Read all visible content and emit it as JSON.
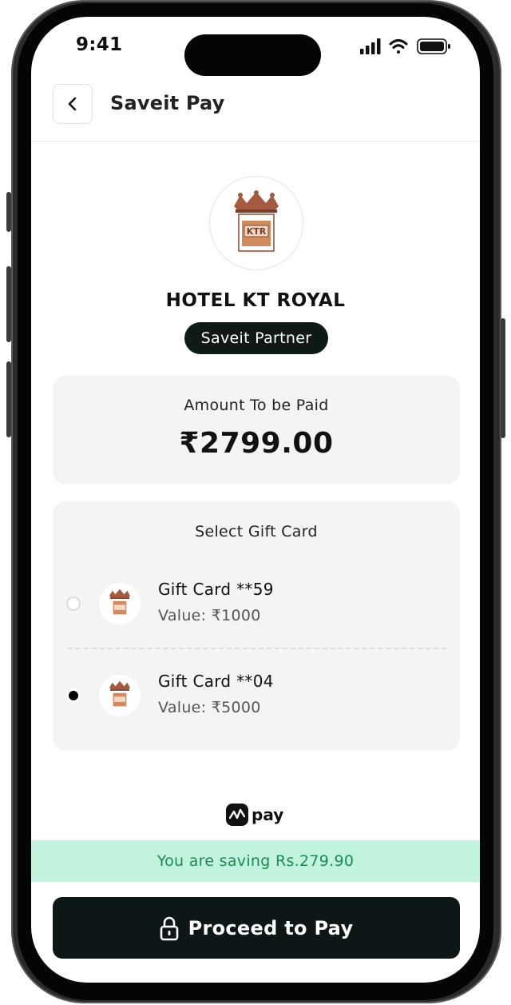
{
  "status_bar": {
    "time": "9:41"
  },
  "header": {
    "title": "Saveit Pay"
  },
  "merchant": {
    "logo_icon": "ktr-hotel-logo-icon",
    "logo_text": "KTR",
    "name": "HOTEL KT ROYAL",
    "badge": "Saveit Partner"
  },
  "amount": {
    "label": "Amount To be Paid",
    "value": "₹2799.00"
  },
  "gift_cards": {
    "title": "Select Gift Card",
    "items": [
      {
        "name": "Gift Card **59",
        "value": "Value: ₹1000",
        "selected": false
      },
      {
        "name": "Gift Card **04",
        "value": "Value: ₹5000",
        "selected": true
      }
    ]
  },
  "brand": {
    "pay_text": "pay"
  },
  "saving": {
    "text": "You are saving Rs.279.90",
    "color": "#1b8b52",
    "background": "#c2f3de"
  },
  "cta": {
    "label": "Proceed to Pay",
    "icon": "lock-icon",
    "background": "#0d1716"
  }
}
